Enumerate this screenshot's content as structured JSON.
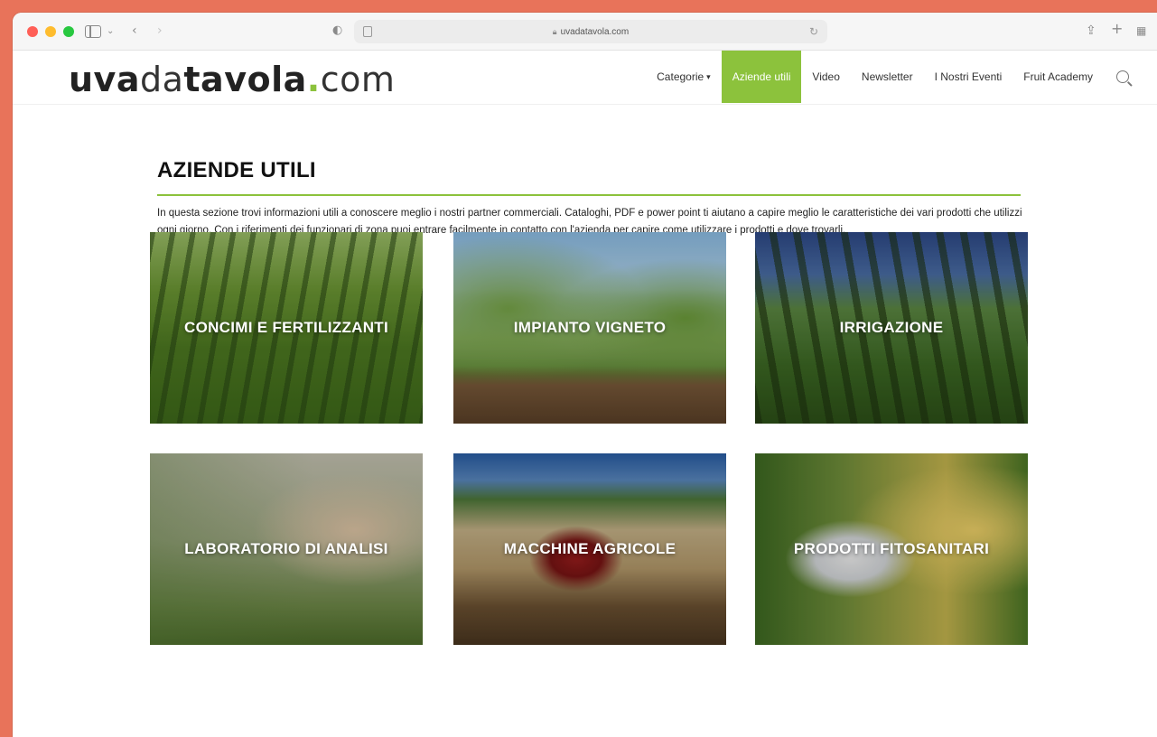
{
  "browser": {
    "url": "uvadatavola.com"
  },
  "header": {
    "logo": {
      "part1": "uva",
      "part2": "da",
      "part3": "tavola",
      "dot": ".",
      "part4": "com"
    },
    "nav": {
      "categorie": "Categorie",
      "aziende_utili": "Aziende utili",
      "video": "Video",
      "newsletter": "Newsletter",
      "eventi": "I Nostri Eventi",
      "academy": "Fruit Academy"
    }
  },
  "main": {
    "title": "AZIENDE UTILI",
    "intro": "In questa sezione trovi informazioni utili a conoscere meglio i nostri partner commerciali. Cataloghi, PDF e power point ti aiutano a capire meglio le caratteristiche dei vari prodotti che utilizzi ogni giorno. Con i riferimenti dei funzionari di zona puoi entrare facilmente in contatto con l'azienda per capire come utilizzare i prodotti e dove trovarli.",
    "cards": [
      {
        "label": "CONCIMI E FERTILIZZANTI"
      },
      {
        "label": "IMPIANTO VIGNETO"
      },
      {
        "label": "IRRIGAZIONE"
      },
      {
        "label": "LABORATORIO DI ANALISI"
      },
      {
        "label": "MACCHINE AGRICOLE"
      },
      {
        "label": "PRODOTTI FITOSANITARI"
      }
    ]
  },
  "colors": {
    "accent": "#8cc23c",
    "background": "#e8735a"
  }
}
